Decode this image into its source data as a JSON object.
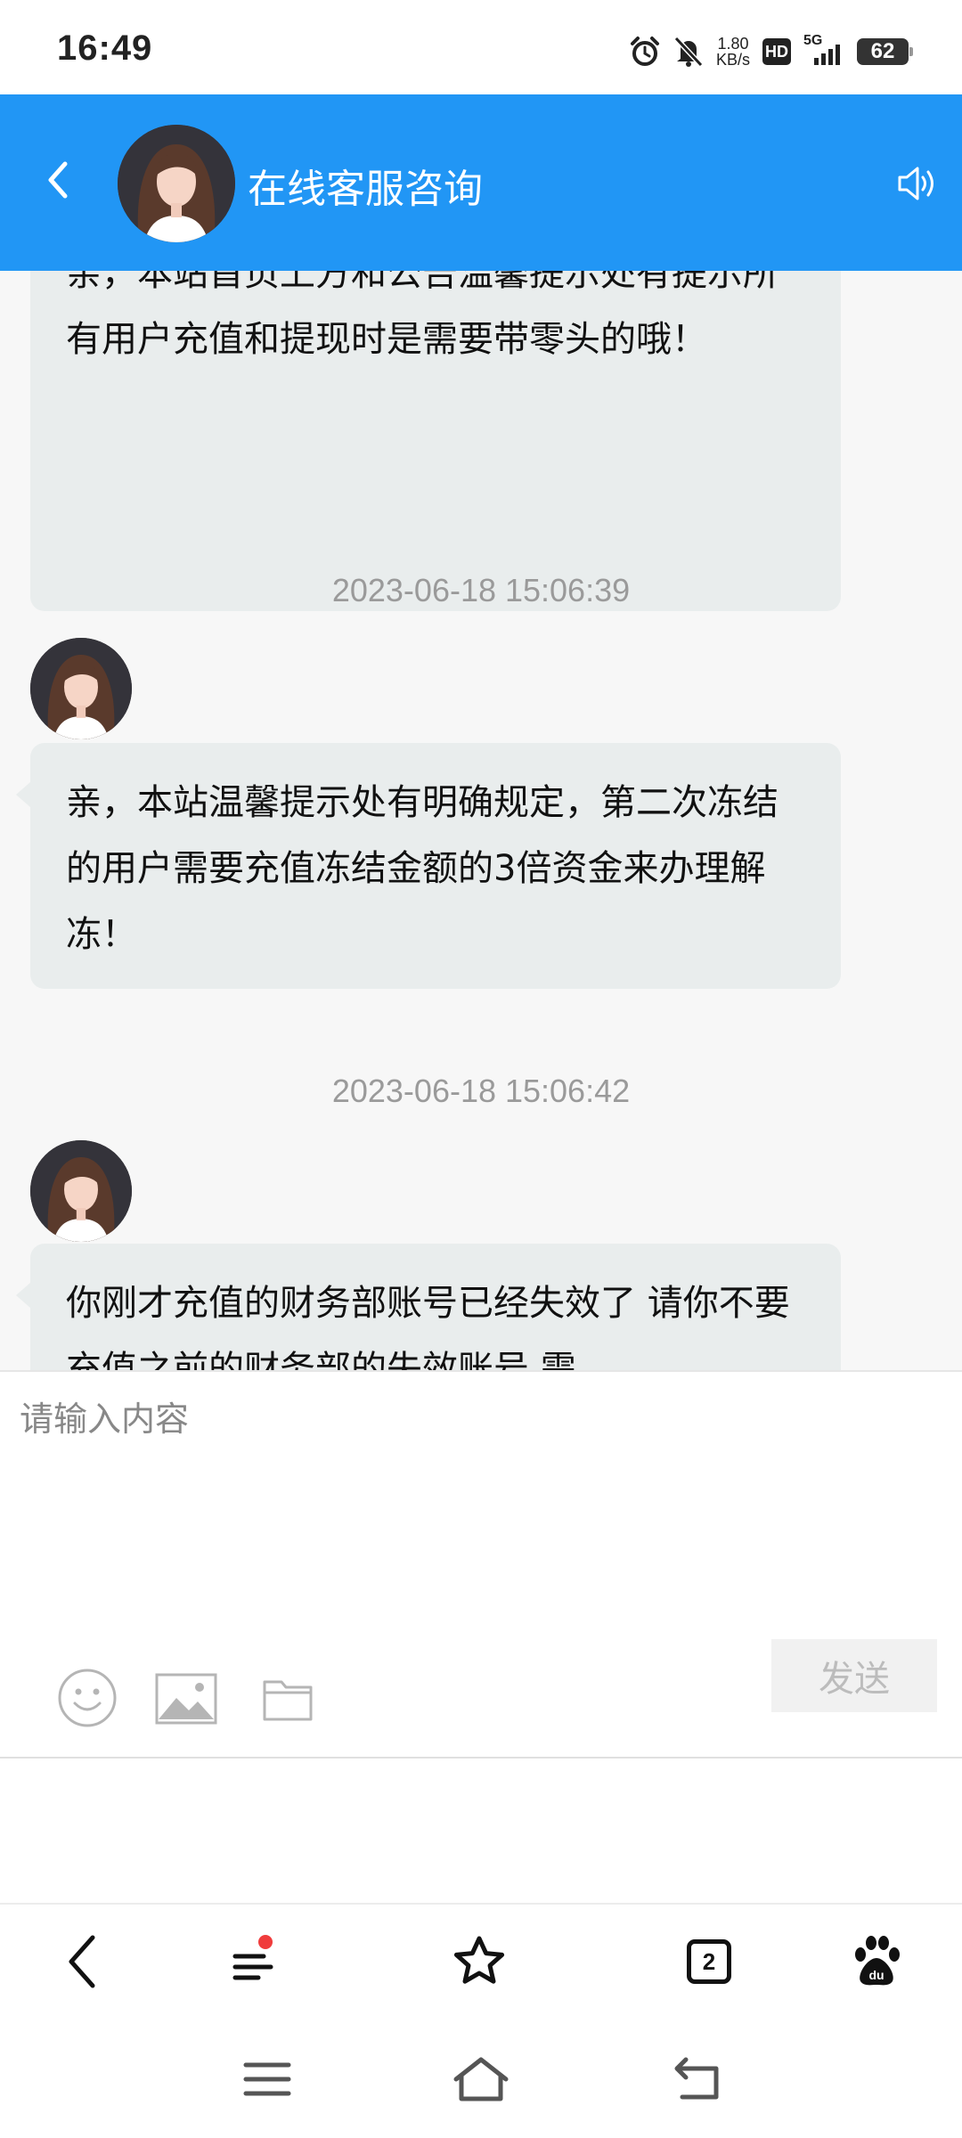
{
  "status_bar": {
    "time": "16:49",
    "net_speed_value": "1.80",
    "net_speed_unit": "KB/s",
    "hd_label": "HD",
    "network_type": "5G",
    "battery_level": "62"
  },
  "header": {
    "title": "在线客服咨询",
    "color": "#2196f5"
  },
  "messages": [
    {
      "text": "亲，本站首页上方和公告温馨提示处有提示所有用户充值和提现时是需要带零头的哦！"
    },
    {
      "timestamp": "2023-06-18 15:06:39",
      "text": "亲，本站温馨提示处有明确规定，第二次冻结的用户需要充值冻结金额的3倍资金来办理解冻！"
    },
    {
      "timestamp": "2023-06-18 15:06:42",
      "text": "你刚才充值的财务部账号已经失效了 请你不要充值之前的财务部的失效账号 需"
    }
  ],
  "input": {
    "placeholder": "请输入内容",
    "send_label": "发送"
  },
  "browser_toolbar": {
    "tab_count": "2"
  },
  "icons": {
    "back": "chevron-left-icon",
    "sound": "speaker-icon",
    "emoji": "smiley-icon",
    "image": "image-icon",
    "file": "folder-icon",
    "menu": "menu-icon",
    "bookmark": "star-icon",
    "tabs": "tabs-icon",
    "baidu": "baidu-paw-icon",
    "home": "home-icon",
    "recent": "recent-apps-icon",
    "return": "return-icon"
  }
}
